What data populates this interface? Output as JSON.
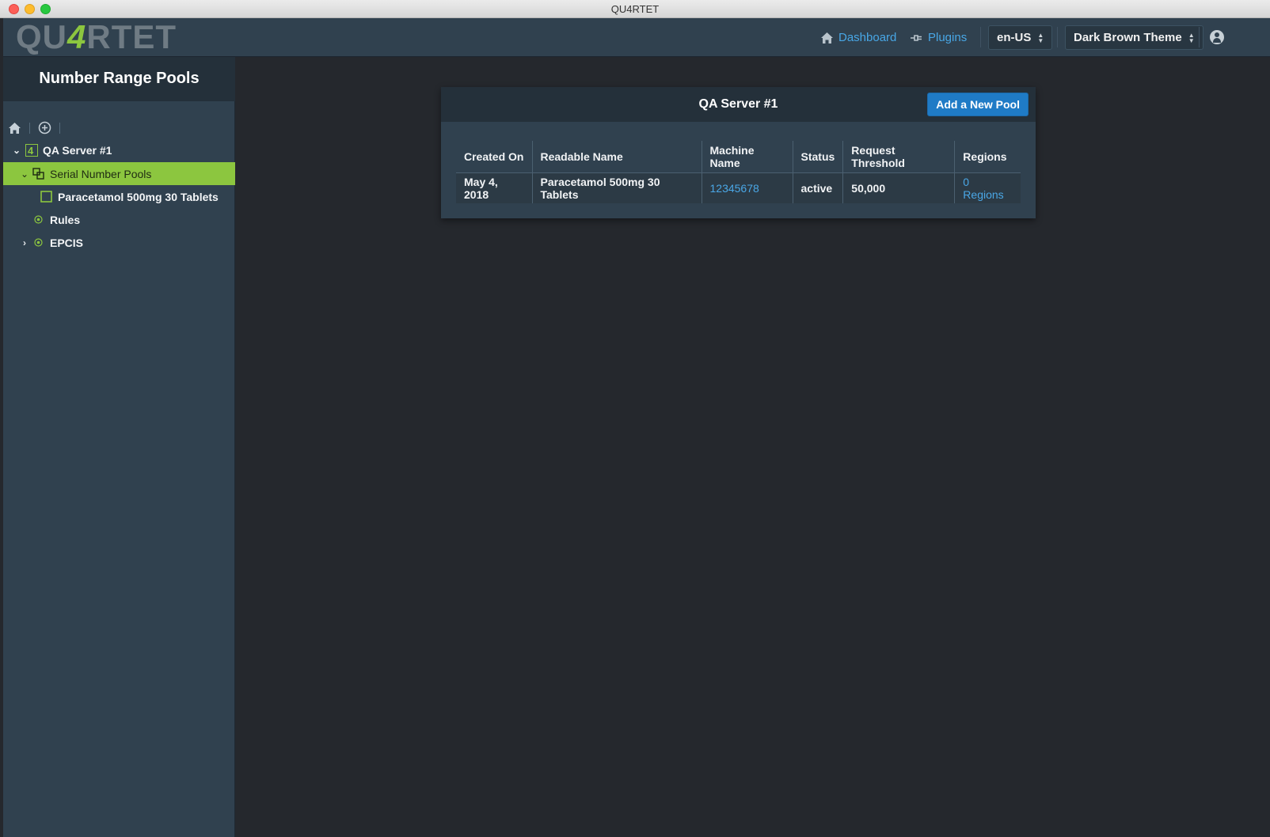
{
  "window": {
    "title": "QU4RTET"
  },
  "topbar": {
    "logo_left": "QU",
    "logo_four": "4",
    "logo_right": "RTET",
    "nav": {
      "dashboard_label": "Dashboard",
      "plugins_label": "Plugins"
    },
    "language_select": "en-US",
    "theme_select": "Dark Brown Theme"
  },
  "sidebar": {
    "title": "Number Range Pools",
    "tree": {
      "server": "QA Server #1",
      "serial_pools": "Serial Number Pools",
      "pool_item": "Paracetamol 500mg 30 Tablets",
      "rules": "Rules",
      "epcis": "EPCIS"
    }
  },
  "panel": {
    "title": "QA Server #1",
    "add_button": "Add a New Pool",
    "columns": [
      "Created On",
      "Readable Name",
      "Machine Name",
      "Status",
      "Request Threshold",
      "Regions"
    ],
    "rows": [
      {
        "created_on": "May 4, 2018",
        "readable_name": "Paracetamol 500mg 30 Tablets",
        "machine_name": "12345678",
        "status": "active",
        "request_threshold": "50,000",
        "regions": "0 Regions"
      }
    ]
  },
  "colors": {
    "accent_green": "#8cc63f",
    "link_blue": "#48a7e6",
    "button_blue": "#1f7bc6",
    "sidebar_bg": "#30414f",
    "main_bg": "#25282d"
  }
}
